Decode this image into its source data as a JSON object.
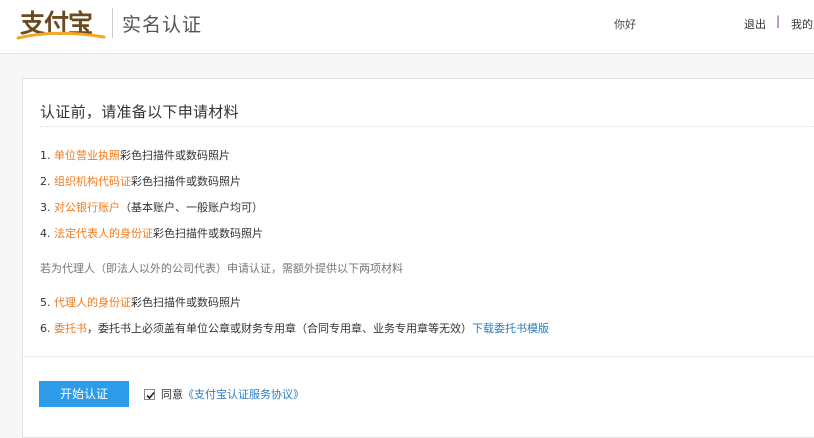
{
  "header": {
    "logo_text": "支付宝",
    "page_heading": "实名认证",
    "greeting": "你好",
    "logout": "退出",
    "separator": "|",
    "mine": "我的支"
  },
  "main": {
    "title": "认证前，请准备以下申请材料",
    "items": [
      {
        "num": "1.",
        "highlight": "单位营业执照",
        "rest": "彩色扫描件或数码照片"
      },
      {
        "num": "2.",
        "highlight": "组织机构代码证",
        "rest": "彩色扫描件或数码照片"
      },
      {
        "num": "3.",
        "highlight": "对公银行账户",
        "rest": "（基本账户、一般账户均可）"
      },
      {
        "num": "4.",
        "highlight": "法定代表人的身份证",
        "rest": "彩色扫描件或数码照片"
      }
    ],
    "agent_note": "若为代理人（即法人以外的公司代表）申请认证，需额外提供以下两项材料",
    "agent_items": [
      {
        "num": "5.",
        "highlight": "代理人的身份证",
        "rest": "彩色扫描件或数码照片"
      },
      {
        "num": "6.",
        "highlight": "委托书",
        "rest": "，委托书上必须盖有单位公章或财务专用章（合同专用章、业务专用章等无效）",
        "link": "下载委托书模版"
      }
    ]
  },
  "actions": {
    "start_label": "开始认证",
    "agree_checked": true,
    "agree_prefix": "同意",
    "agreement_link": "《支付宝认证服务协议》"
  },
  "colors": {
    "highlight": "#f37b1d",
    "link": "#2a7ec4",
    "button": "#2d9be8",
    "logo": "#6b4a1f",
    "logo_swoosh": "#f5a623"
  }
}
